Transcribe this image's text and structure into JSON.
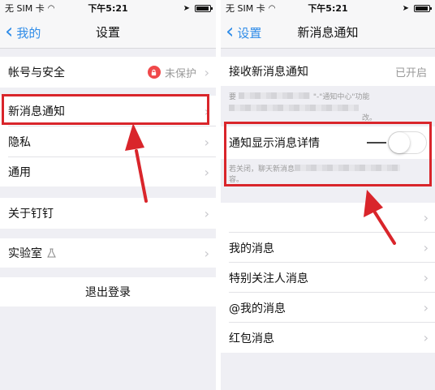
{
  "left": {
    "status": {
      "carrier": "无 SIM 卡",
      "time": "下午5:21"
    },
    "nav": {
      "back_label": "我的",
      "title": "设置"
    },
    "items": {
      "account": {
        "label": "帐号与安全",
        "value": "未保护"
      },
      "notify": {
        "label": "新消息通知"
      },
      "privacy": {
        "label": "隐私"
      },
      "general": {
        "label": "通用"
      },
      "about": {
        "label": "关于钉钉"
      },
      "lab": {
        "label": "实验室"
      }
    },
    "logout_label": "退出登录"
  },
  "right": {
    "status": {
      "carrier": "无 SIM 卡",
      "time": "下午5:21"
    },
    "nav": {
      "back_label": "设置",
      "title": "新消息通知"
    },
    "receive": {
      "label": "接收新消息通知",
      "value": "已开启"
    },
    "receive_hint": {
      "prefix": "要",
      "mid": "\"-\"通知中心\"功能",
      "line2_tail": "改。"
    },
    "detail": {
      "label": "通知显示消息详情",
      "toggle_on": false
    },
    "detail_hint": {
      "line1": "若关闭，聊天新消息",
      "line2": "容。"
    },
    "items": [
      {
        "label": ""
      },
      {
        "label": "我的消息"
      },
      {
        "label": "特别关注人消息"
      },
      {
        "label": "@我的消息"
      },
      {
        "label": "红包消息"
      }
    ]
  },
  "colors": {
    "accent": "#2f8ce8",
    "annotation": "#d9252b",
    "badge": "#f0484a"
  },
  "icons": [
    "signal-wifi-icon",
    "location-icon",
    "battery-icon",
    "chevron-left-icon",
    "chevron-right-icon",
    "lock-icon",
    "flask-icon",
    "annotation-arrow"
  ]
}
